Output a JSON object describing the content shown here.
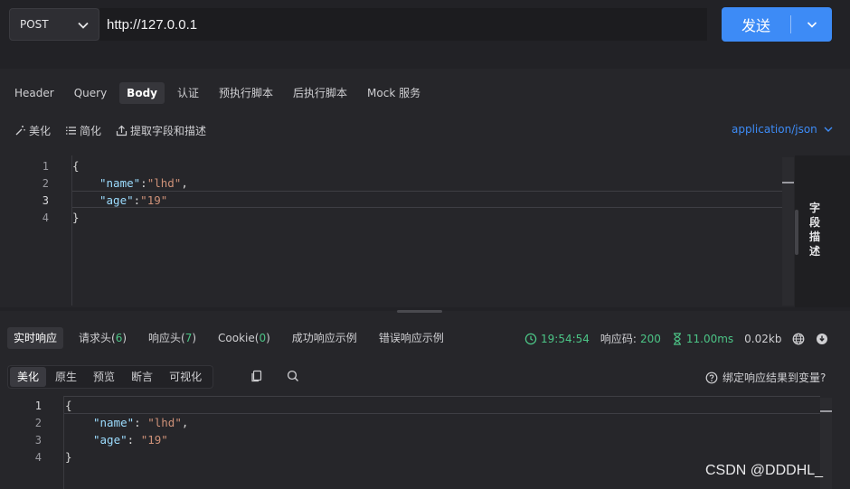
{
  "request": {
    "method": "POST",
    "url": "http://127.0.0.1",
    "send_label": "发送"
  },
  "req_tabs": [
    {
      "label": "Header"
    },
    {
      "label": "Query"
    },
    {
      "label": "Body",
      "active": true
    },
    {
      "label": "认证"
    },
    {
      "label": "预执行脚本"
    },
    {
      "label": "后执行脚本"
    },
    {
      "label": "Mock 服务"
    }
  ],
  "body_tools": {
    "beautify": "美化",
    "simplify": "简化",
    "extract": "提取字段和描述",
    "content_type": "application/json"
  },
  "request_body": {
    "line_numbers": [
      "1",
      "2",
      "3",
      "4"
    ],
    "line1": "{",
    "name_key": "\"name\"",
    "name_val": "\"lhd\"",
    "age_key": "\"age\"",
    "age_val": "\"19\"",
    "line4": "}"
  },
  "field_desc_label": "字段描述",
  "response_tabs": {
    "realtime": "实时响应",
    "req_headers": "请求头(",
    "req_headers_count": "6",
    "resp_headers": "响应头(",
    "resp_headers_count": "7",
    "cookie": "Cookie(",
    "cookie_count": "0",
    "close_paren": ")",
    "success_example": "成功响应示例",
    "error_example": "错误响应示例"
  },
  "status": {
    "time": "19:54:54",
    "code_label": "响应码:",
    "code": "200",
    "duration": "11.00ms",
    "size": "0.02kb"
  },
  "format_options": [
    "美化",
    "原生",
    "预览",
    "断言",
    "可视化"
  ],
  "bind_var_label": "绑定响应结果到变量?",
  "response_body": {
    "line_numbers": [
      "1",
      "2",
      "3",
      "4"
    ],
    "line1": "{",
    "name_key": "\"name\"",
    "name_val": "\"lhd\"",
    "age_key": "\"age\"",
    "age_val": "\"19\"",
    "line4": "}"
  },
  "watermark": "CSDN @DDDHL_",
  "colors": {
    "accent": "#3d8bf6",
    "success": "#4cc486",
    "key": "#9cdcfe",
    "string": "#ce9178"
  }
}
